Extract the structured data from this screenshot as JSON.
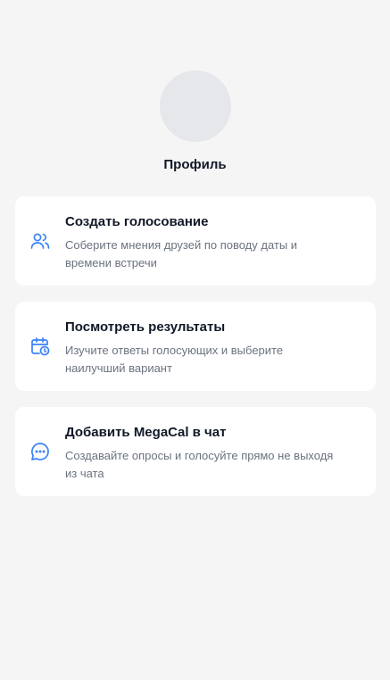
{
  "profile": {
    "label": "Профиль"
  },
  "cards": [
    {
      "title": "Создать голосование",
      "description": "Соберите мнения друзей по поводу даты и времени встречи",
      "icon": "users-icon"
    },
    {
      "title": "Посмотреть результаты",
      "description": "Изучите ответы голосующих и выберите наилучший вариант",
      "icon": "calendar-clock-icon"
    },
    {
      "title": "Добавить MegaCal в чат",
      "description": "Создавайте опросы и голосуйте прямо не выходя из чата",
      "icon": "chat-bubble-icon"
    }
  ],
  "colors": {
    "accent": "#3b82f6",
    "background": "#f5f5f5",
    "card": "#ffffff",
    "avatar": "#e5e7eb"
  }
}
